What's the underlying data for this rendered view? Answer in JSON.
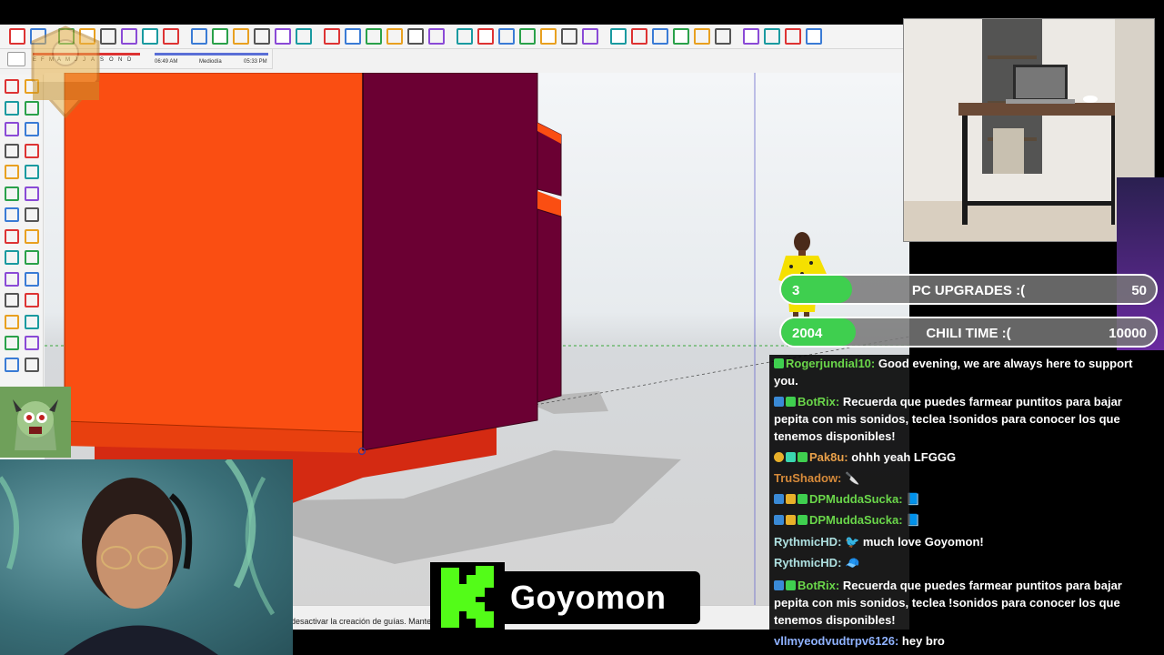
{
  "app": {
    "name": "SketchUp",
    "status_text": "desactivar la creación de guías. Mantene"
  },
  "toolbar_top": {
    "icons": [
      "select-icon",
      "eraser-icon",
      "paint-bucket-icon",
      "arc-icon",
      "rectangle-icon",
      "push-pull-icon",
      "follow-me-icon",
      "move-icon",
      "rotate-icon",
      "scale-icon",
      "offset-icon",
      "tape-measure-icon",
      "text-icon",
      "paint-icon",
      "orbit-icon",
      "pan-icon",
      "zoom-icon",
      "zoom-extents-icon",
      "sandbox-icon",
      "smoove-icon",
      "stamp-icon",
      "drape-icon",
      "geo-location-icon",
      "components-icon",
      "warehouse-icon",
      "home-icon",
      "extension-icon",
      "section-icon",
      "iso-view-icon",
      "top-view-icon",
      "front-view-icon",
      "right-view-icon",
      "back-view-icon",
      "left-view-icon",
      "xray-icon",
      "wireframe-icon",
      "hidden-line-icon",
      "shaded-icon",
      "textured-icon"
    ]
  },
  "shadow_toolbar": {
    "months": [
      "E",
      "F",
      "M",
      "A",
      "M",
      "J",
      "J",
      "A",
      "S",
      "O",
      "N",
      "D"
    ],
    "time_start": "06:49 AM",
    "time_mid": "Mediodía",
    "time_end": "05:33 PM"
  },
  "webcam": {
    "streamer": "streamer"
  },
  "goals": [
    {
      "count": "3",
      "title": "PC UPGRADES :(",
      "target": "50",
      "progress": 0.06
    },
    {
      "count": "2004",
      "title": "CHILI TIME :(",
      "target": "10000",
      "progress": 0.2
    }
  ],
  "chat": {
    "messages": [
      {
        "user": "Rogerjundial10:",
        "user_color": "#6ad64a",
        "text": " Good evening, we are always here to support you."
      },
      {
        "user": "BotRix:",
        "user_color": "#6ad64a",
        "text": " Recuerda que puedes farmear puntitos para bajar pepita con mis sonidos, teclea !sonidos para conocer los que tenemos disponibles!"
      },
      {
        "user": "Pak8u:",
        "user_color": "#e8a04a",
        "text": " ohhh yeah LFGGG"
      },
      {
        "user": "TruShadow:",
        "user_color": "#d68a3a",
        "text": " 🔪"
      },
      {
        "user": "DPMuddaSucka:",
        "user_color": "#6ad64a",
        "text": " 📘"
      },
      {
        "user": "DPMuddaSucka:",
        "user_color": "#6ad64a",
        "text": " 📘"
      },
      {
        "user": "RythmicHD:",
        "user_color": "#aee0e0",
        "text": " 🐦 much love Goyomon!"
      },
      {
        "user": "RythmicHD:",
        "user_color": "#aee0e0",
        "text": " 🧢"
      },
      {
        "user": "BotRix:",
        "user_color": "#6ad64a",
        "text": " Recuerda que puedes farmear puntitos para bajar pepita con mis sonidos, teclea !sonidos para conocer los que tenemos disponibles!"
      },
      {
        "user": "vllmyeodvudtrpv6126:",
        "user_color": "#8fb2ff",
        "text": " hey bro"
      }
    ]
  },
  "kick": {
    "channel": "Goyomon"
  },
  "colors": {
    "orange_face": "#fa4e12",
    "purple_face": "#6b0033",
    "goal_fill": "#3fcf4f",
    "kick_green": "#53fc18"
  }
}
